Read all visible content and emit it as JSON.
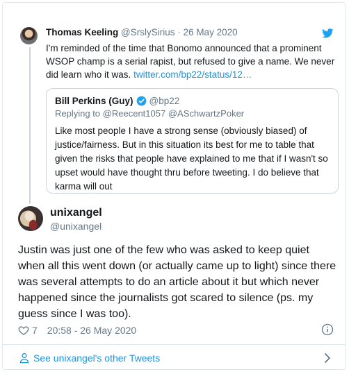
{
  "parent_tweet": {
    "author_name": "Thomas Keeling",
    "author_handle": "@SrslySirius",
    "separator": "·",
    "date": "26 May 2020",
    "text": "I'm reminded of the time that Bonomo announced that a prominent WSOP champ is a serial rapist, but refused to give a name. We never did learn who it was.",
    "link": "twitter.com/bp22/status/12…"
  },
  "quoted_tweet": {
    "author_name": "Bill Perkins (Guy)",
    "author_handle": "@bp22",
    "replying_prefix": "Replying to",
    "replying_to_1": "@Reecent1057",
    "replying_to_2": "@ASchwartzPoker",
    "text": "Like most people I have a strong sense  (obviously biased) of justice/fairness. But in this situation its best for me to table that given the risks that people have explained to me that if I wasn't so upset would have thought thru before tweeting. I do believe that karma will out"
  },
  "main_tweet": {
    "author_name": "unixangel",
    "author_handle": "@unixangel",
    "text": "Justin was just one of the few who was asked to keep quiet when all this went down (or actually came up to light) since there was several attempts to do an article about it but which never happened since the journalists got scared to silence (ps. my guess since I was too).",
    "likes": "7",
    "timestamp": "20:58 - 26 May 2020"
  },
  "footer": {
    "label": "See unixangel's other Tweets"
  },
  "colors": {
    "accent": "#1b95e0",
    "secondary_text": "#657786",
    "border": "#e1e8ed"
  },
  "icons": {
    "twitter_logo": "twitter-bird-icon",
    "verified": "verified-badge-icon",
    "like": "heart-icon",
    "info": "info-icon",
    "profile": "person-icon",
    "more": "chevron-right-icon"
  }
}
